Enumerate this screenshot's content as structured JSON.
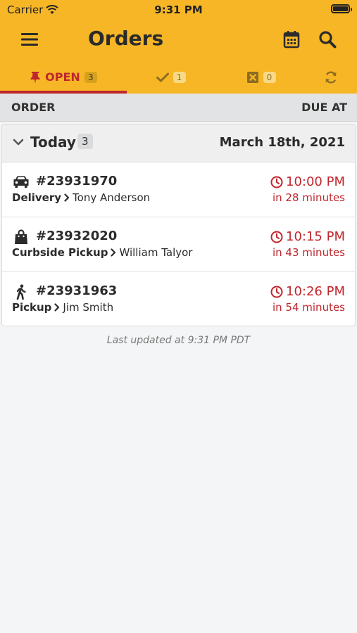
{
  "status_bar": {
    "carrier": "Carrier",
    "time": "9:31 PM"
  },
  "header": {
    "title": "Orders"
  },
  "tabs": [
    {
      "label": "OPEN",
      "count": "3",
      "icon": "pin-icon",
      "active": true
    },
    {
      "label": "",
      "count": "1",
      "icon": "check-icon",
      "active": false
    },
    {
      "label": "",
      "count": "0",
      "icon": "cancelled-icon",
      "active": false
    }
  ],
  "columns": {
    "order": "ORDER",
    "due": "DUE AT"
  },
  "group": {
    "title": "Today",
    "count": "3",
    "date": "March 18th, 2021"
  },
  "orders": [
    {
      "number": "#23931970",
      "method": "Delivery",
      "customer": "Tony Anderson",
      "due_time": "10:00 PM",
      "relative": "in 28 minutes",
      "icon": "car-icon"
    },
    {
      "number": "#23932020",
      "method": "Curbside Pickup",
      "customer": "William Talyor",
      "due_time": "10:15 PM",
      "relative": "in 43 minutes",
      "icon": "bag-icon"
    },
    {
      "number": "#23931963",
      "method": "Pickup",
      "customer": "Jim Smith",
      "due_time": "10:26 PM",
      "relative": "in 54 minutes",
      "icon": "walking-icon"
    }
  ],
  "footer": {
    "last_updated": "Last updated at 9:31 PM PDT"
  },
  "colors": {
    "brand": "#f6b626",
    "accent_red": "#c0262d",
    "text": "#2b2b2b"
  }
}
